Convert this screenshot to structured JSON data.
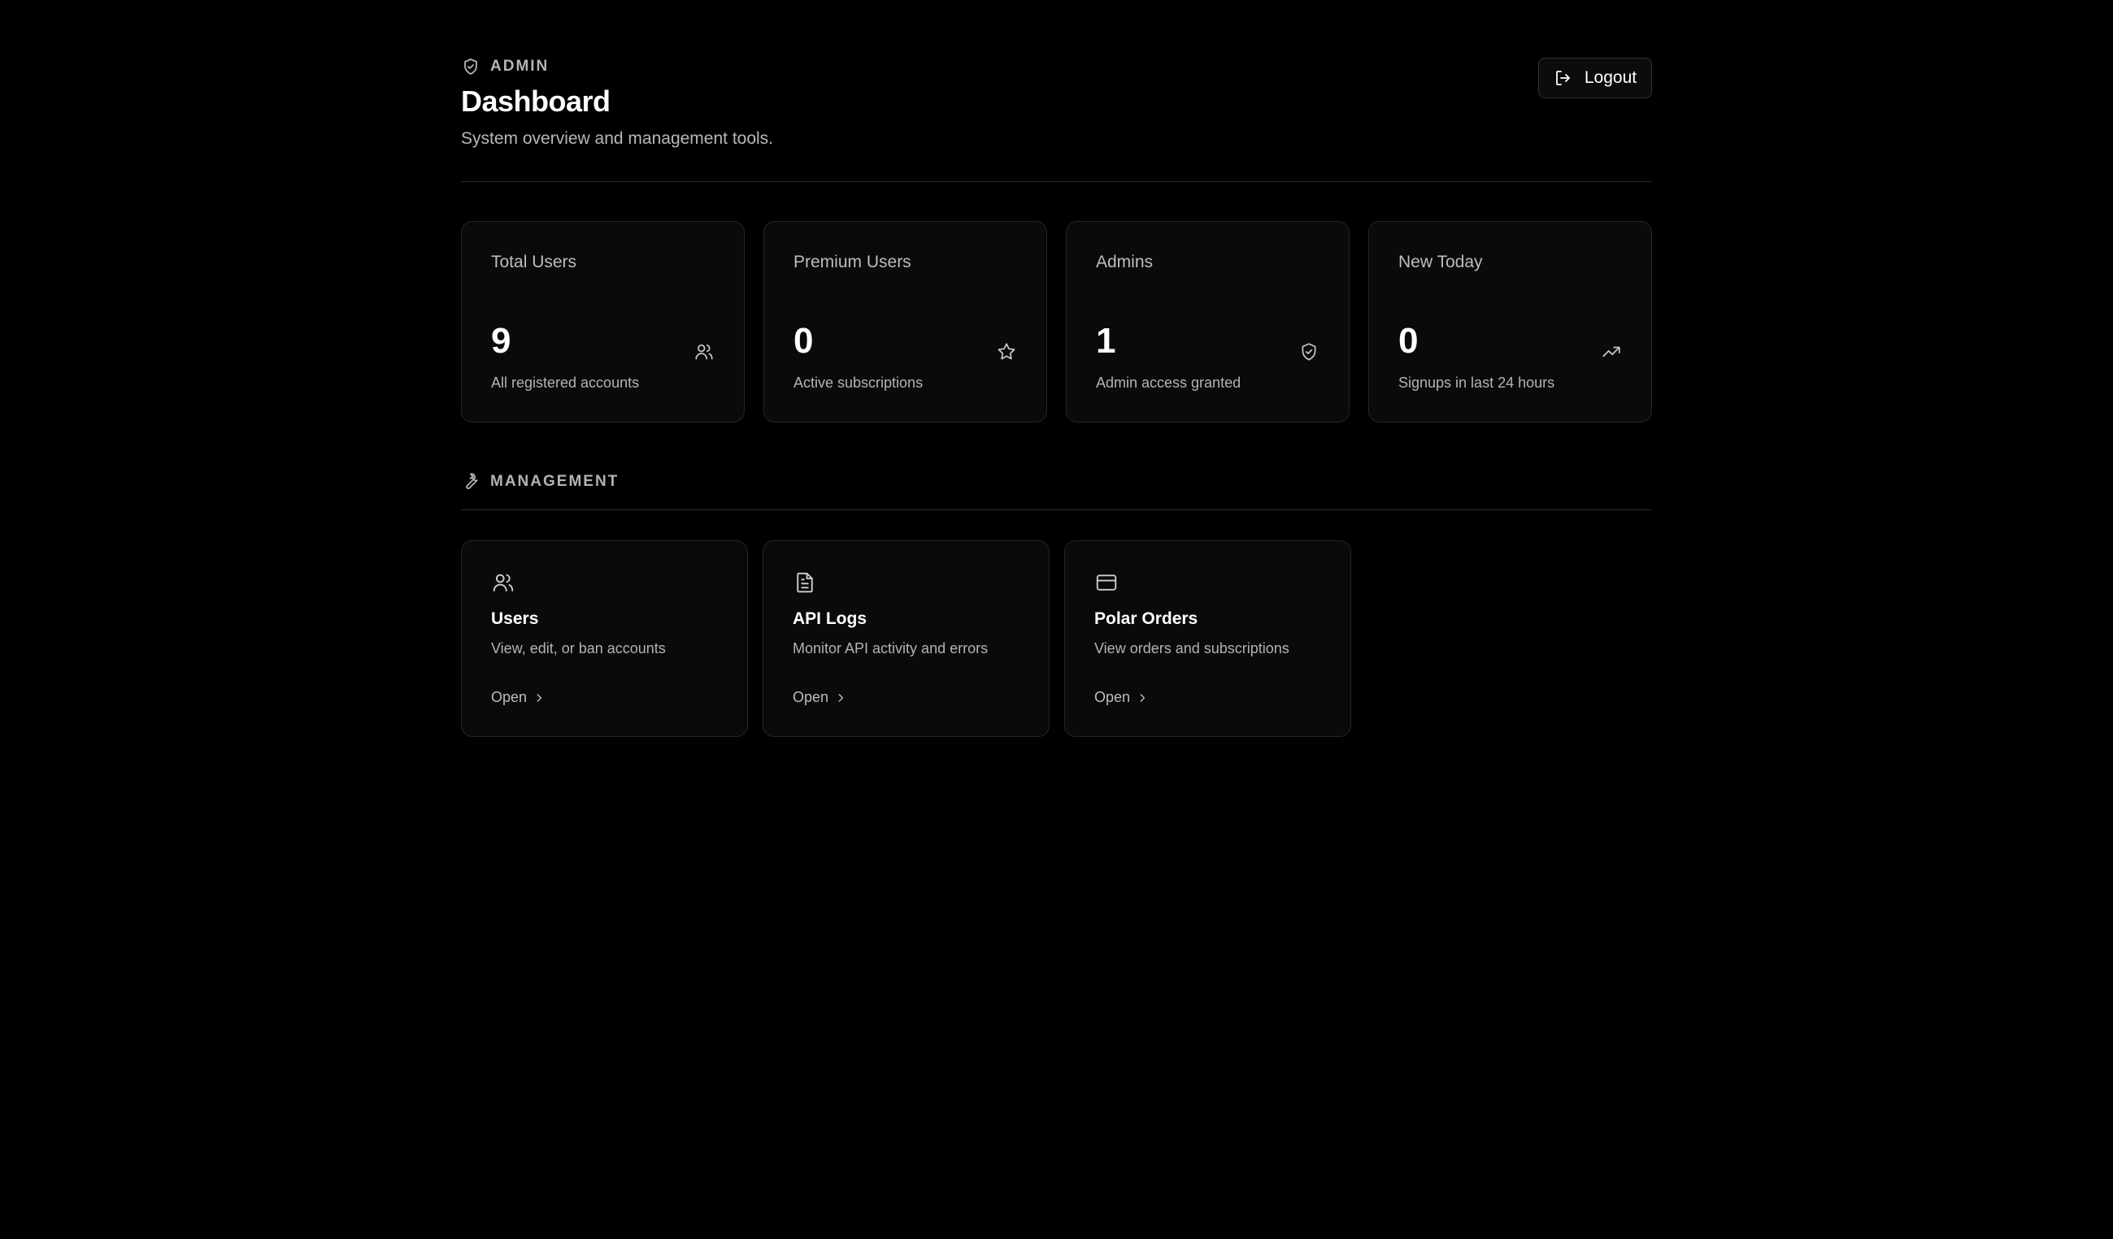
{
  "header": {
    "eyebrow": "ADMIN",
    "title": "Dashboard",
    "subtitle": "System overview and management tools.",
    "logout_label": "Logout"
  },
  "stats": [
    {
      "label": "Total Users",
      "value": "9",
      "description": "All registered accounts",
      "icon": "users-icon"
    },
    {
      "label": "Premium Users",
      "value": "0",
      "description": "Active subscriptions",
      "icon": "star-icon"
    },
    {
      "label": "Admins",
      "value": "1",
      "description": "Admin access granted",
      "icon": "shield-check-icon"
    },
    {
      "label": "New Today",
      "value": "0",
      "description": "Signups in last 24 hours",
      "icon": "trending-up-icon"
    }
  ],
  "management": {
    "heading": "MANAGEMENT",
    "cards": [
      {
        "title": "Users",
        "description": "View, edit, or ban accounts",
        "open_label": "Open",
        "icon": "users-icon"
      },
      {
        "title": "API Logs",
        "description": "Monitor API activity and errors",
        "open_label": "Open",
        "icon": "file-text-icon"
      },
      {
        "title": "Polar Orders",
        "description": "View orders and subscriptions",
        "open_label": "Open",
        "icon": "credit-card-icon"
      }
    ]
  }
}
